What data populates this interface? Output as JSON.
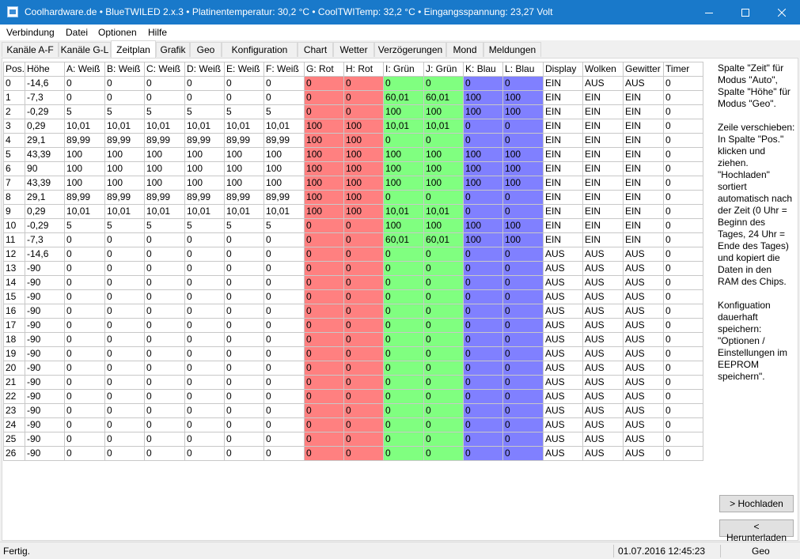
{
  "window": {
    "title": "Coolhardware.de • BlueTWILED 2.x.3 • Platinentemperatur: 30,2 °C • CoolTWITemp: 32,2 °C • Eingangsspannung: 23,27 Volt",
    "titlebar_color": "#1979ca"
  },
  "menu": [
    "Verbindung",
    "Datei",
    "Optionen",
    "Hilfe"
  ],
  "tabs": [
    "Kanäle A-F",
    "Kanäle G-L",
    "Zeitplan",
    "Grafik",
    "Geo",
    "Konfiguration",
    "Chart",
    "Wetter",
    "Verzögerungen",
    "Mond",
    "Meldungen"
  ],
  "active_tab": "Zeitplan",
  "table": {
    "columns": [
      "Pos.",
      "Höhe",
      "A: Weiß",
      "B: Weiß",
      "C: Weiß",
      "D: Weiß",
      "E: Weiß",
      "F: Weiß",
      "G: Rot",
      "H: Rot",
      "I: Grün",
      "J: Grün",
      "K: Blau",
      "L: Blau",
      "Display",
      "Wolken",
      "Gewitter",
      "Timer"
    ],
    "colors": {
      "red": "#ff8080",
      "green": "#80ff80",
      "blue": "#8080ff"
    },
    "rows": [
      [
        "0",
        "-14,6",
        "0",
        "0",
        "0",
        "0",
        "0",
        "0",
        "0",
        "0",
        "0",
        "0",
        "0",
        "0",
        "EIN",
        "AUS",
        "AUS",
        "0"
      ],
      [
        "1",
        "-7,3",
        "0",
        "0",
        "0",
        "0",
        "0",
        "0",
        "0",
        "0",
        "60,01",
        "60,01",
        "100",
        "100",
        "EIN",
        "EIN",
        "EIN",
        "0"
      ],
      [
        "2",
        "-0,29",
        "5",
        "5",
        "5",
        "5",
        "5",
        "5",
        "0",
        "0",
        "100",
        "100",
        "100",
        "100",
        "EIN",
        "EIN",
        "EIN",
        "0"
      ],
      [
        "3",
        "0,29",
        "10,01",
        "10,01",
        "10,01",
        "10,01",
        "10,01",
        "10,01",
        "100",
        "100",
        "10,01",
        "10,01",
        "0",
        "0",
        "EIN",
        "EIN",
        "EIN",
        "0"
      ],
      [
        "4",
        "29,1",
        "89,99",
        "89,99",
        "89,99",
        "89,99",
        "89,99",
        "89,99",
        "100",
        "100",
        "0",
        "0",
        "0",
        "0",
        "EIN",
        "EIN",
        "EIN",
        "0"
      ],
      [
        "5",
        "43,39",
        "100",
        "100",
        "100",
        "100",
        "100",
        "100",
        "100",
        "100",
        "100",
        "100",
        "100",
        "100",
        "EIN",
        "EIN",
        "EIN",
        "0"
      ],
      [
        "6",
        "90",
        "100",
        "100",
        "100",
        "100",
        "100",
        "100",
        "100",
        "100",
        "100",
        "100",
        "100",
        "100",
        "EIN",
        "EIN",
        "EIN",
        "0"
      ],
      [
        "7",
        "43,39",
        "100",
        "100",
        "100",
        "100",
        "100",
        "100",
        "100",
        "100",
        "100",
        "100",
        "100",
        "100",
        "EIN",
        "EIN",
        "EIN",
        "0"
      ],
      [
        "8",
        "29,1",
        "89,99",
        "89,99",
        "89,99",
        "89,99",
        "89,99",
        "89,99",
        "100",
        "100",
        "0",
        "0",
        "0",
        "0",
        "EIN",
        "EIN",
        "EIN",
        "0"
      ],
      [
        "9",
        "0,29",
        "10,01",
        "10,01",
        "10,01",
        "10,01",
        "10,01",
        "10,01",
        "100",
        "100",
        "10,01",
        "10,01",
        "0",
        "0",
        "EIN",
        "EIN",
        "EIN",
        "0"
      ],
      [
        "10",
        "-0,29",
        "5",
        "5",
        "5",
        "5",
        "5",
        "5",
        "0",
        "0",
        "100",
        "100",
        "100",
        "100",
        "EIN",
        "EIN",
        "EIN",
        "0"
      ],
      [
        "11",
        "-7,3",
        "0",
        "0",
        "0",
        "0",
        "0",
        "0",
        "0",
        "0",
        "60,01",
        "60,01",
        "100",
        "100",
        "EIN",
        "EIN",
        "EIN",
        "0"
      ],
      [
        "12",
        "-14,6",
        "0",
        "0",
        "0",
        "0",
        "0",
        "0",
        "0",
        "0",
        "0",
        "0",
        "0",
        "0",
        "AUS",
        "AUS",
        "AUS",
        "0"
      ],
      [
        "13",
        "-90",
        "0",
        "0",
        "0",
        "0",
        "0",
        "0",
        "0",
        "0",
        "0",
        "0",
        "0",
        "0",
        "AUS",
        "AUS",
        "AUS",
        "0"
      ],
      [
        "14",
        "-90",
        "0",
        "0",
        "0",
        "0",
        "0",
        "0",
        "0",
        "0",
        "0",
        "0",
        "0",
        "0",
        "AUS",
        "AUS",
        "AUS",
        "0"
      ],
      [
        "15",
        "-90",
        "0",
        "0",
        "0",
        "0",
        "0",
        "0",
        "0",
        "0",
        "0",
        "0",
        "0",
        "0",
        "AUS",
        "AUS",
        "AUS",
        "0"
      ],
      [
        "16",
        "-90",
        "0",
        "0",
        "0",
        "0",
        "0",
        "0",
        "0",
        "0",
        "0",
        "0",
        "0",
        "0",
        "AUS",
        "AUS",
        "AUS",
        "0"
      ],
      [
        "17",
        "-90",
        "0",
        "0",
        "0",
        "0",
        "0",
        "0",
        "0",
        "0",
        "0",
        "0",
        "0",
        "0",
        "AUS",
        "AUS",
        "AUS",
        "0"
      ],
      [
        "18",
        "-90",
        "0",
        "0",
        "0",
        "0",
        "0",
        "0",
        "0",
        "0",
        "0",
        "0",
        "0",
        "0",
        "AUS",
        "AUS",
        "AUS",
        "0"
      ],
      [
        "19",
        "-90",
        "0",
        "0",
        "0",
        "0",
        "0",
        "0",
        "0",
        "0",
        "0",
        "0",
        "0",
        "0",
        "AUS",
        "AUS",
        "AUS",
        "0"
      ],
      [
        "20",
        "-90",
        "0",
        "0",
        "0",
        "0",
        "0",
        "0",
        "0",
        "0",
        "0",
        "0",
        "0",
        "0",
        "AUS",
        "AUS",
        "AUS",
        "0"
      ],
      [
        "21",
        "-90",
        "0",
        "0",
        "0",
        "0",
        "0",
        "0",
        "0",
        "0",
        "0",
        "0",
        "0",
        "0",
        "AUS",
        "AUS",
        "AUS",
        "0"
      ],
      [
        "22",
        "-90",
        "0",
        "0",
        "0",
        "0",
        "0",
        "0",
        "0",
        "0",
        "0",
        "0",
        "0",
        "0",
        "AUS",
        "AUS",
        "AUS",
        "0"
      ],
      [
        "23",
        "-90",
        "0",
        "0",
        "0",
        "0",
        "0",
        "0",
        "0",
        "0",
        "0",
        "0",
        "0",
        "0",
        "AUS",
        "AUS",
        "AUS",
        "0"
      ],
      [
        "24",
        "-90",
        "0",
        "0",
        "0",
        "0",
        "0",
        "0",
        "0",
        "0",
        "0",
        "0",
        "0",
        "0",
        "AUS",
        "AUS",
        "AUS",
        "0"
      ],
      [
        "25",
        "-90",
        "0",
        "0",
        "0",
        "0",
        "0",
        "0",
        "0",
        "0",
        "0",
        "0",
        "0",
        "0",
        "AUS",
        "AUS",
        "AUS",
        "0"
      ],
      [
        "26",
        "-90",
        "0",
        "0",
        "0",
        "0",
        "0",
        "0",
        "0",
        "0",
        "0",
        "0",
        "0",
        "0",
        "AUS",
        "AUS",
        "AUS",
        "0"
      ]
    ]
  },
  "help": {
    "p1": "Spalte \"Zeit\" für Modus \"Auto\", Spalte \"Höhe\" für Modus \"Geo\".",
    "p2": "Zeile verschieben: In Spalte \"Pos.\" klicken und ziehen. \"Hochladen\" sortiert automatisch nach der Zeit (0 Uhr = Beginn des Tages, 24 Uhr = Ende des Tages) und kopiert die Daten in den RAM des Chips.",
    "p3": "Konfiguation dauerhaft speichern: \"Optionen / Einstellungen im EEPROM speichern\"."
  },
  "buttons": {
    "upload": "> Hochladen",
    "download": "< Herunterladen"
  },
  "status": {
    "text": "Fertig.",
    "datetime": "01.07.2016 12:45:23",
    "mode": "Geo"
  }
}
